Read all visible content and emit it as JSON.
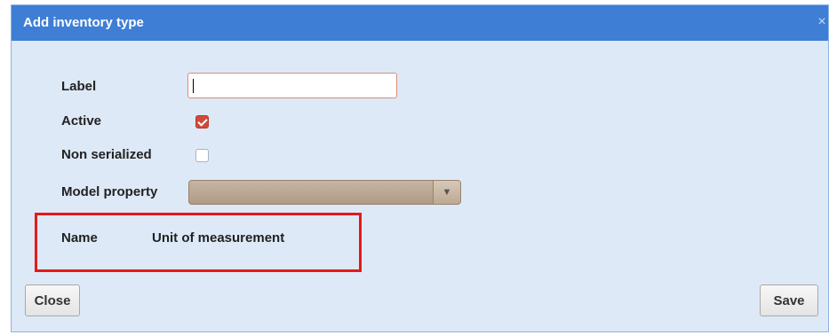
{
  "dialog": {
    "title": "Add inventory type",
    "close_icon": "×"
  },
  "form": {
    "label": {
      "caption": "Label",
      "value": "",
      "placeholder": ""
    },
    "active": {
      "caption": "Active",
      "checked": true
    },
    "non_serialized": {
      "caption": "Non serialized",
      "checked": false
    },
    "model_property": {
      "caption": "Model property",
      "value": "",
      "arrow": "▼"
    }
  },
  "properties_table": {
    "columns": [
      "Name",
      "Unit of measurement"
    ]
  },
  "buttons": {
    "close": "Close",
    "save": "Save"
  },
  "colors": {
    "titlebar": "#3e7ed5",
    "dialog_bg": "#dde9f6",
    "highlight_box": "#e51919",
    "checkbox_checked": "#d04a3a"
  }
}
